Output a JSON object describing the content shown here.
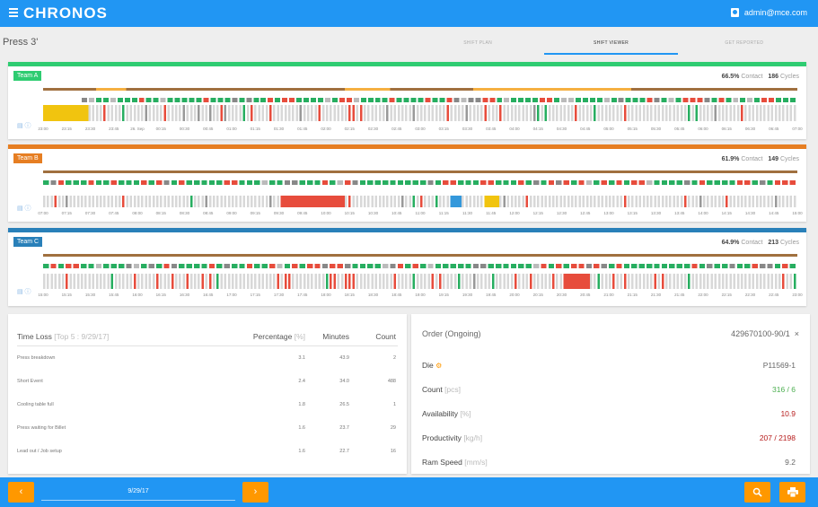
{
  "app": {
    "brand": "CHRONOS",
    "user": "admin@mce.com"
  },
  "page": {
    "title": "Press 3'"
  },
  "tabs": [
    {
      "label": "SHIFT PLAN"
    },
    {
      "label": "SHIFT VIEWER"
    },
    {
      "label": "GET REPORTED"
    }
  ],
  "colors": {
    "primary": "#2196f3",
    "accent": "#ff9800",
    "team_a": "#2ecc71",
    "team_b": "#e67e22",
    "team_c": "#2980b9",
    "ok": "#27ae60",
    "loss": "#e74c3c",
    "idle": "#f1c40f",
    "setup": "#3498db",
    "order_stripe": "#a0703f"
  },
  "teams": [
    {
      "label": "Team A",
      "contact_pct": "66.5%",
      "contact_label": "Contact",
      "cycles": "186",
      "cycles_label": "Cycles",
      "times": [
        "23:00",
        "23:15",
        "23:30",
        "23:45",
        "26. Sep",
        "00:15",
        "00:30",
        "00:45",
        "01:00",
        "01:15",
        "01:30",
        "01:45",
        "02:00",
        "02:15",
        "02:30",
        "02:45",
        "03:00",
        "03:15",
        "03:30",
        "03:45",
        "04:00",
        "04:15",
        "04:30",
        "04:45",
        "05:00",
        "05:15",
        "05:30",
        "05:45",
        "06:00",
        "06:15",
        "06:30",
        "06:45",
        "07:00"
      ]
    },
    {
      "label": "Team B",
      "contact_pct": "61.9%",
      "contact_label": "Contact",
      "cycles": "149",
      "cycles_label": "Cycles",
      "times": [
        "07:00",
        "07:15",
        "07:30",
        "07:45",
        "08:00",
        "08:15",
        "08:30",
        "08:45",
        "09:00",
        "09:15",
        "09:30",
        "09:45",
        "10:00",
        "10:15",
        "10:30",
        "10:45",
        "11:00",
        "11:15",
        "11:30",
        "11:45",
        "12:00",
        "12:15",
        "12:30",
        "12:45",
        "13:00",
        "13:15",
        "13:30",
        "13:45",
        "14:00",
        "14:15",
        "14:30",
        "14:45",
        "15:00"
      ]
    },
    {
      "label": "Team C",
      "contact_pct": "64.9%",
      "contact_label": "Contact",
      "cycles": "213",
      "cycles_label": "Cycles",
      "times": [
        "15:00",
        "15:15",
        "15:30",
        "15:45",
        "16:00",
        "16:15",
        "16:30",
        "16:45",
        "17:00",
        "17:15",
        "17:30",
        "17:45",
        "18:00",
        "18:15",
        "18:30",
        "18:45",
        "19:00",
        "19:15",
        "19:30",
        "19:45",
        "20:00",
        "20:15",
        "20:30",
        "20:45",
        "21:00",
        "21:15",
        "21:30",
        "21:45",
        "22:00",
        "22:15",
        "22:30",
        "22:45",
        "23:00"
      ]
    }
  ],
  "lane_icons": "▤ ⓘ",
  "time_loss": {
    "title": "Time Loss",
    "subtitle": "[Top 5 : 9/29/17]",
    "col_percentage": "Percentage",
    "col_percentage_unit": "[%]",
    "col_minutes": "Minutes",
    "col_count": "Count",
    "rows": [
      {
        "label": "Press breakdown",
        "pct": "3.1",
        "min": "43.9",
        "count": "2"
      },
      {
        "label": "Short Event",
        "pct": "2.4",
        "min": "34.0",
        "count": "488"
      },
      {
        "label": "Cooling table full",
        "pct": "1.8",
        "min": "26.5",
        "count": "1"
      },
      {
        "label": "Press waiting for Billet",
        "pct": "1.6",
        "min": "23.7",
        "count": "29"
      },
      {
        "label": "Lead out / Job setup",
        "pct": "1.6",
        "min": "22.7",
        "count": "16"
      }
    ]
  },
  "order": {
    "title": "Order (Ongoing)",
    "id": "429670100-90/1",
    "close": "×",
    "rows": [
      {
        "label": "Die",
        "unit": "",
        "value": "P11569-1",
        "color": "#666666"
      },
      {
        "label": "Count",
        "unit": "[pcs]",
        "value": "316 / 6",
        "color": "#4caf50"
      },
      {
        "label": "Availability",
        "unit": "[%]",
        "value": "10.9",
        "color": "#b71c1c"
      },
      {
        "label": "Productivity",
        "unit": "[kg/h]",
        "value": "207 / 2198",
        "color": "#b71c1c"
      },
      {
        "label": "Ram Speed",
        "unit": "[mm/s]",
        "value": "9.2",
        "color": "#666666"
      }
    ]
  },
  "footer": {
    "prev": "‹",
    "next": "›",
    "date": "9/29/17",
    "search_icon": "🔍",
    "print_icon": "⎙"
  }
}
